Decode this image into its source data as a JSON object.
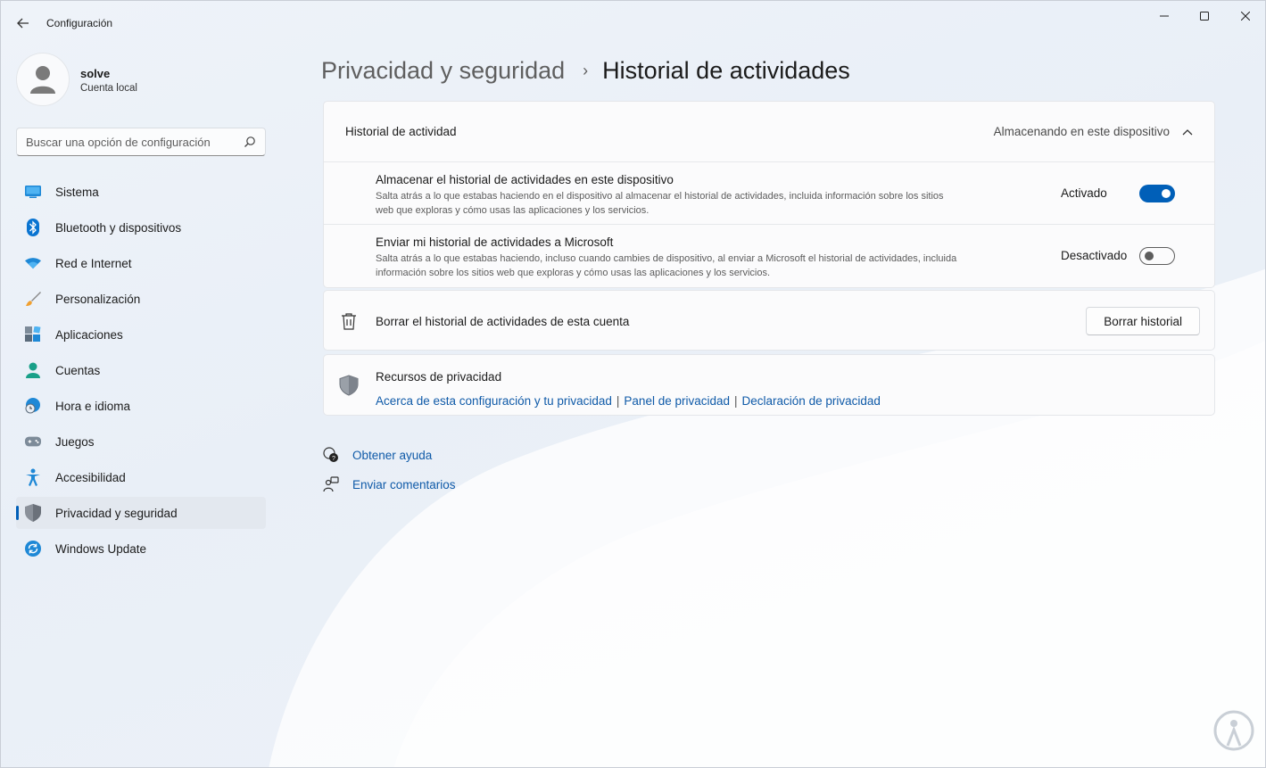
{
  "window": {
    "title": "Configuración",
    "back_icon": "back-arrow-icon",
    "controls": [
      "minimize-icon",
      "maximize-icon",
      "close-icon"
    ]
  },
  "profile": {
    "name": "solve",
    "account_type": "Cuenta local"
  },
  "search": {
    "placeholder": "Buscar una opción de configuración",
    "value": ""
  },
  "sidebar": {
    "items": [
      {
        "label": "Sistema",
        "icon": "monitor-icon"
      },
      {
        "label": "Bluetooth y dispositivos",
        "icon": "bluetooth-icon"
      },
      {
        "label": "Red e Internet",
        "icon": "wifi-icon"
      },
      {
        "label": "Personalización",
        "icon": "paintbrush-icon"
      },
      {
        "label": "Aplicaciones",
        "icon": "apps-icon"
      },
      {
        "label": "Cuentas",
        "icon": "person-icon"
      },
      {
        "label": "Hora e idioma",
        "icon": "globe-clock-icon"
      },
      {
        "label": "Juegos",
        "icon": "gamepad-icon"
      },
      {
        "label": "Accesibilidad",
        "icon": "accessibility-icon"
      },
      {
        "label": "Privacidad y seguridad",
        "icon": "shield-icon",
        "active": true
      },
      {
        "label": "Windows Update",
        "icon": "update-icon"
      }
    ]
  },
  "breadcrumb": {
    "parent": "Privacidad y seguridad",
    "separator": "›",
    "current": "Historial de actividades"
  },
  "activity_card": {
    "title": "Historial de actividad",
    "state": "Almacenando en este dispositivo",
    "expanded": true,
    "rows": [
      {
        "title": "Almacenar el historial de actividades en este dispositivo",
        "desc_line1": "Salta atrás a lo que estabas haciendo en el dispositivo al almacenar el historial de actividades, incluida información sobre los sitios",
        "desc_line2": "web que exploras y cómo usas las aplicaciones y los servicios.",
        "state_label": "Activado",
        "on": true
      },
      {
        "title": "Enviar mi historial de actividades a Microsoft",
        "desc_line1": "Salta atrás a lo que estabas haciendo, incluso cuando cambies de dispositivo, al enviar a Microsoft el historial de actividades, incluida",
        "desc_line2": "información sobre los sitios web que exploras y cómo usas las aplicaciones y los servicios.",
        "state_label": "Desactivado",
        "on": false
      }
    ]
  },
  "clear_card": {
    "title": "Borrar el historial de actividades de esta cuenta",
    "button": "Borrar historial",
    "icon": "trash-icon"
  },
  "resources_card": {
    "title": "Recursos de privacidad",
    "icon": "shield-icon",
    "links": [
      "Acerca de esta configuración y tu privacidad",
      "Panel de privacidad",
      "Declaración de privacidad"
    ],
    "separator": "|"
  },
  "help": {
    "get_help": "Obtener ayuda",
    "feedback": "Enviar comentarios"
  },
  "colors": {
    "accent": "#005fb8",
    "link": "#0f5aa8"
  }
}
